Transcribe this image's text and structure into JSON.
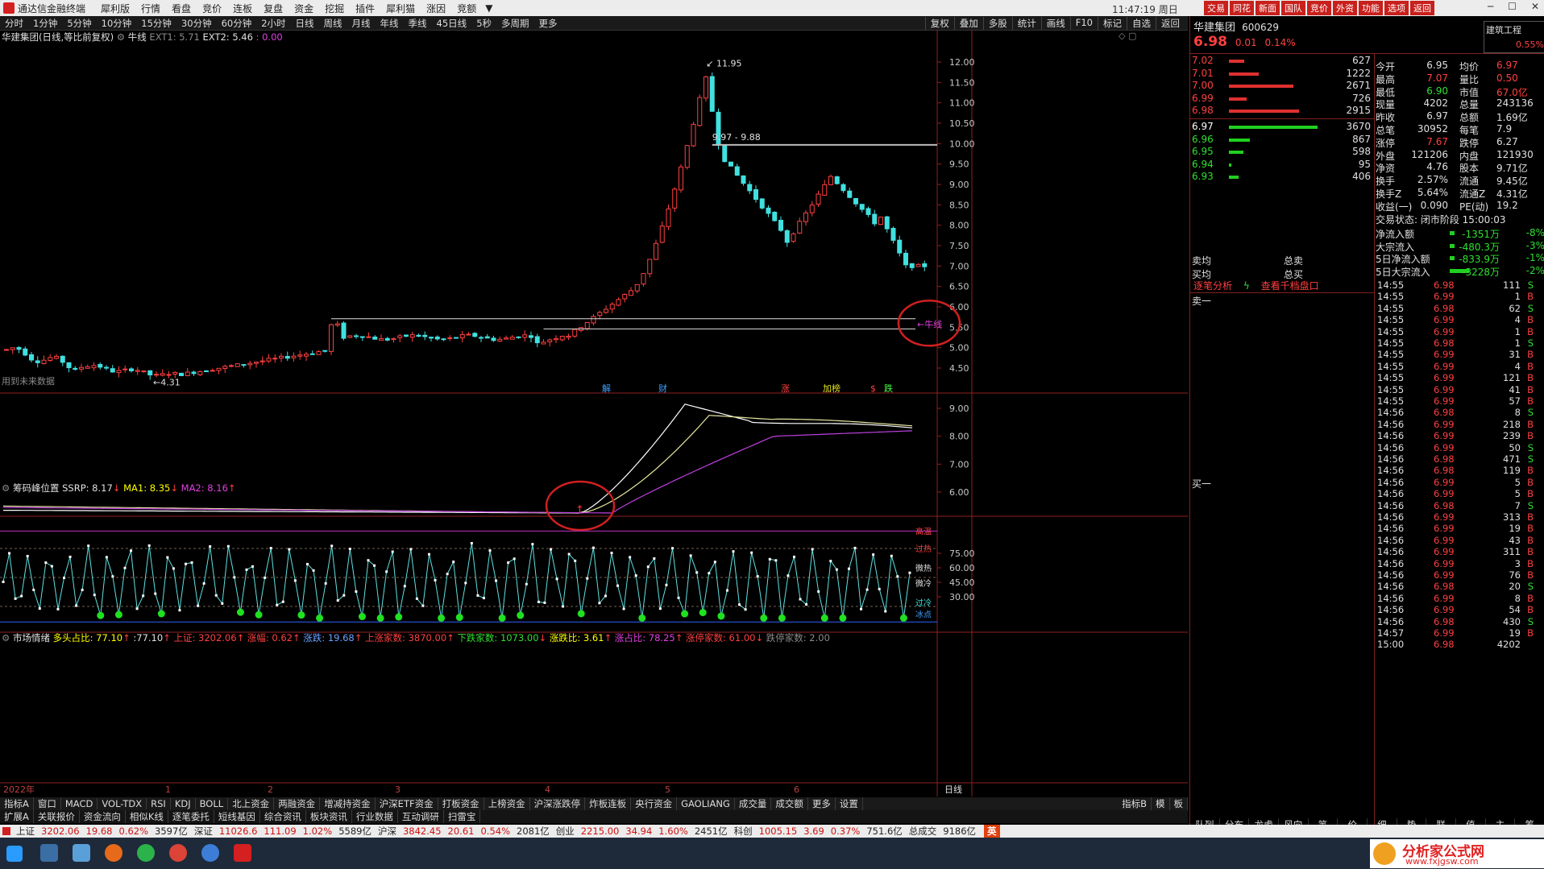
{
  "app": {
    "title": "通达信金融终端",
    "menus": [
      "犀利版",
      "行情",
      "看盘",
      "竞价",
      "连板",
      "复盘",
      "资金",
      "挖掘",
      "插件",
      "犀利猫",
      "涨因",
      "竞额"
    ],
    "clock": "11:47:19 周日",
    "right_buttons": [
      "交易",
      "同花",
      "新面",
      "国队",
      "竞价",
      "外资",
      "功能",
      "选项",
      "返回"
    ],
    "accent": "#c8201c"
  },
  "periods": [
    "分时",
    "1分钟",
    "5分钟",
    "10分钟",
    "15分钟",
    "30分钟",
    "60分钟",
    "2小时",
    "日线",
    "周线",
    "月线",
    "年线",
    "季线",
    "45日线",
    "5秒",
    "多周期",
    "更多"
  ],
  "chart_tools": [
    "复权",
    "叠加",
    "多股",
    "统计",
    "画线",
    "F10",
    "标记",
    "自选",
    "返回"
  ],
  "main_chart": {
    "header_name": "华建集团(日线,等比前复权)",
    "indicator": "牛线",
    "ext1_label": "EXT1: 5.71",
    "ext2_label": "EXT2: 5.46",
    "ext3": ": 0.00",
    "future_note": "用到未来数据",
    "high_label": "11.95",
    "low_label": "4.31",
    "range_label": "9.97 - 9.88",
    "niu_label": "牛线",
    "event_tags": [
      "解",
      "财",
      "涨",
      "加榜",
      "$",
      "跌"
    ],
    "y_ticks": [
      "12.00",
      "11.50",
      "11.00",
      "10.50",
      "10.00",
      "9.50",
      "9.00",
      "8.50",
      "8.00",
      "7.50",
      "7.00",
      "6.50",
      "6.00",
      "5.50",
      "5.00",
      "4.50"
    ]
  },
  "chip_panel": {
    "title": "筹码峰位置",
    "ssrp": "SSRP: 8.17",
    "ma1": "MA1: 8.35",
    "ma2": "MA2: 8.16",
    "y_ticks": [
      "9.00",
      "8.00",
      "7.00",
      "6.00"
    ]
  },
  "mood_panel": {
    "title": "市场情绪",
    "long_short": "多头占比: 77.10",
    "v2": ":77.10",
    "shangzheng": "上证: 3202.06",
    "zhangfu": "涨幅: 0.62",
    "zhangdie": "涨跌: 19.68",
    "up_count": "上涨家数: 3870.00",
    "down_count": "下跌家数: 1073.00",
    "ratio": "涨跌比: 3.61",
    "up_pct": "涨占比: 78.25",
    "limit_up": "涨停家数: 61.00",
    "limit_down": "跌停家数: 2.00",
    "y_ticks": [
      "75.00",
      "60.00",
      "45.00",
      "30.00"
    ],
    "zone_labels": [
      "高温",
      "过热",
      "微热",
      "微冷",
      "过冷",
      "冰点"
    ],
    "x_labels": [
      "2022年",
      "1",
      "2",
      "3",
      "4",
      "5",
      "6"
    ],
    "x_right": "日线"
  },
  "indicator_tabs": [
    "指标A",
    "窗口",
    "MACD",
    "VOL-TDX",
    "RSI",
    "KDJ",
    "BOLL",
    "北上资金",
    "两融资金",
    "增减持资金",
    "沪深ETF资金",
    "打板资金",
    "上榜资金",
    "沪深涨跌停",
    "炸板连板",
    "央行资金",
    "GAOLIANG",
    "成交量",
    "成交额",
    "更多",
    "设置"
  ],
  "indicator_tabs_right": [
    "指标B",
    "模",
    "板"
  ],
  "extension_tabs": [
    "扩展A",
    "关联报价",
    "资金流向",
    "相似K线",
    "逐笔委托",
    "短线基因",
    "综合资讯",
    "板块资讯",
    "行业数据",
    "互动调研",
    "扫雷宝"
  ],
  "quote": {
    "name": "华建集团",
    "code": "600629",
    "sector": "建筑工程",
    "price": "6.98",
    "change": "0.01",
    "change_pct": "0.14%",
    "sector_pct": "0.55%",
    "sell_levels": [
      {
        "price": "7.02",
        "vol": "627"
      },
      {
        "price": "7.01",
        "vol": "1222"
      },
      {
        "price": "7.00",
        "vol": "2671"
      },
      {
        "price": "6.99",
        "vol": "726"
      },
      {
        "price": "6.98",
        "vol": "2915"
      }
    ],
    "buy_levels": [
      {
        "price": "6.97",
        "vol": "3670"
      },
      {
        "price": "6.96",
        "vol": "867"
      },
      {
        "price": "6.95",
        "vol": "598"
      },
      {
        "price": "6.94",
        "vol": "95"
      },
      {
        "price": "6.93",
        "vol": "406"
      }
    ],
    "stats_left": [
      {
        "k": "今开",
        "v": "6.95",
        "k2": "均价",
        "v2": "6.97"
      },
      {
        "k": "最高",
        "v": "7.07",
        "k2": "量比",
        "v2": "0.50"
      },
      {
        "k": "最低",
        "v": "6.90",
        "k2": "市值",
        "v2": "67.0亿"
      },
      {
        "k": "现量",
        "v": "4202",
        "k2": "总量",
        "v2": "243136"
      },
      {
        "k": "昨收",
        "v": "6.97",
        "k2": "总额",
        "v2": "1.69亿"
      },
      {
        "k": "总笔",
        "v": "30952",
        "k2": "每笔",
        "v2": "7.9"
      },
      {
        "k": "涨停",
        "v": "7.67",
        "k2": "跌停",
        "v2": "6.27"
      },
      {
        "k": "外盘",
        "v": "121206",
        "k2": "内盘",
        "v2": "121930"
      },
      {
        "k": "净资",
        "v": "4.76",
        "k2": "股本",
        "v2": "9.71亿"
      },
      {
        "k": "换手",
        "v": "2.57%",
        "k2": "流通",
        "v2": "9.45亿"
      },
      {
        "k": "换手Z",
        "v": "5.64%",
        "k2": "流通Z",
        "v2": "4.31亿"
      },
      {
        "k": "收益(一)",
        "v": "0.090",
        "k2": "PE(动)",
        "v2": "19.2"
      }
    ],
    "trade_state": "交易状态: 闭市阶段 15:00:03",
    "flows": [
      {
        "k": "净流入额",
        "v": "-1351万",
        "p": "-8%"
      },
      {
        "k": "大宗流入",
        "v": "-480.3万",
        "p": "-3%"
      },
      {
        "k": "5日净流入额",
        "v": "-833.9万",
        "p": "-1%"
      },
      {
        "k": "5日大宗流入",
        "v": "-3228万",
        "p": "-2%"
      }
    ],
    "sell_avg": "卖均",
    "buy_avg": "买均",
    "total_sell": "总卖",
    "total_buy": "总买",
    "links": [
      "逐笔分析",
      "查看千档盘口"
    ],
    "sell1": "卖一",
    "buy1": "买一"
  },
  "ticks": [
    {
      "t": "14:55",
      "p": "6.98",
      "v": "111",
      "s": "S"
    },
    {
      "t": "14:55",
      "p": "6.99",
      "v": "1",
      "s": "B"
    },
    {
      "t": "14:55",
      "p": "6.98",
      "v": "62",
      "s": "S"
    },
    {
      "t": "14:55",
      "p": "6.99",
      "v": "4",
      "s": "B"
    },
    {
      "t": "14:55",
      "p": "6.99",
      "v": "1",
      "s": "B"
    },
    {
      "t": "14:55",
      "p": "6.98",
      "v": "1",
      "s": "S"
    },
    {
      "t": "14:55",
      "p": "6.99",
      "v": "31",
      "s": "B"
    },
    {
      "t": "14:55",
      "p": "6.99",
      "v": "4",
      "s": "B"
    },
    {
      "t": "14:55",
      "p": "6.99",
      "v": "121",
      "s": "B"
    },
    {
      "t": "14:55",
      "p": "6.99",
      "v": "41",
      "s": "B"
    },
    {
      "t": "14:55",
      "p": "6.99",
      "v": "57",
      "s": "B"
    },
    {
      "t": "14:56",
      "p": "6.98",
      "v": "8",
      "s": "S"
    },
    {
      "t": "14:56",
      "p": "6.99",
      "v": "218",
      "s": "B"
    },
    {
      "t": "14:56",
      "p": "6.99",
      "v": "239",
      "s": "B"
    },
    {
      "t": "14:56",
      "p": "6.99",
      "v": "50",
      "s": "S"
    },
    {
      "t": "14:56",
      "p": "6.98",
      "v": "471",
      "s": "S"
    },
    {
      "t": "14:56",
      "p": "6.98",
      "v": "119",
      "s": "B"
    },
    {
      "t": "14:56",
      "p": "6.99",
      "v": "5",
      "s": "B"
    },
    {
      "t": "14:56",
      "p": "6.99",
      "v": "5",
      "s": "B"
    },
    {
      "t": "14:56",
      "p": "6.98",
      "v": "7",
      "s": "S"
    },
    {
      "t": "14:56",
      "p": "6.99",
      "v": "313",
      "s": "B"
    },
    {
      "t": "14:56",
      "p": "6.99",
      "v": "19",
      "s": "B"
    },
    {
      "t": "14:56",
      "p": "6.99",
      "v": "43",
      "s": "B"
    },
    {
      "t": "14:56",
      "p": "6.99",
      "v": "311",
      "s": "B"
    },
    {
      "t": "14:56",
      "p": "6.99",
      "v": "3",
      "s": "B"
    },
    {
      "t": "14:56",
      "p": "6.99",
      "v": "76",
      "s": "B"
    },
    {
      "t": "14:56",
      "p": "6.98",
      "v": "20",
      "s": "S"
    },
    {
      "t": "14:56",
      "p": "6.99",
      "v": "8",
      "s": "B"
    },
    {
      "t": "14:56",
      "p": "6.99",
      "v": "54",
      "s": "B"
    },
    {
      "t": "14:56",
      "p": "6.98",
      "v": "430",
      "s": "S"
    },
    {
      "t": "14:57",
      "p": "6.99",
      "v": "19",
      "s": "B"
    },
    {
      "t": "15:00",
      "p": "6.98",
      "v": "4202",
      "s": ""
    }
  ],
  "right_bottom_tabs": [
    "队列",
    "分布",
    "龙虎",
    "风向",
    "笔",
    "价",
    "细",
    "势",
    "联",
    "值",
    "主",
    "筹"
  ],
  "status": {
    "items": [
      {
        "k": "上证",
        "v": "3202.06",
        "c": "19.68",
        "p": "0.62%",
        "a": "3597亿"
      },
      {
        "k": "深证",
        "v": "11026.6",
        "c": "111.09",
        "p": "1.02%",
        "a": "5589亿"
      },
      {
        "k": "沪深",
        "v": "3842.45",
        "c": "20.61",
        "p": "0.54%",
        "a": "2081亿"
      },
      {
        "k": "创业",
        "v": "2215.00",
        "c": "34.94",
        "p": "1.60%",
        "a": "2451亿"
      },
      {
        "k": "科创",
        "v": "1005.15",
        "c": "3.69",
        "p": "0.37%",
        "a": "751.6亿"
      }
    ],
    "total_label": "总成交",
    "total_value": "9186亿",
    "ime": "英"
  },
  "watermark": {
    "line1": "分析家公式网",
    "line2": "www.fxjgsw.com"
  }
}
